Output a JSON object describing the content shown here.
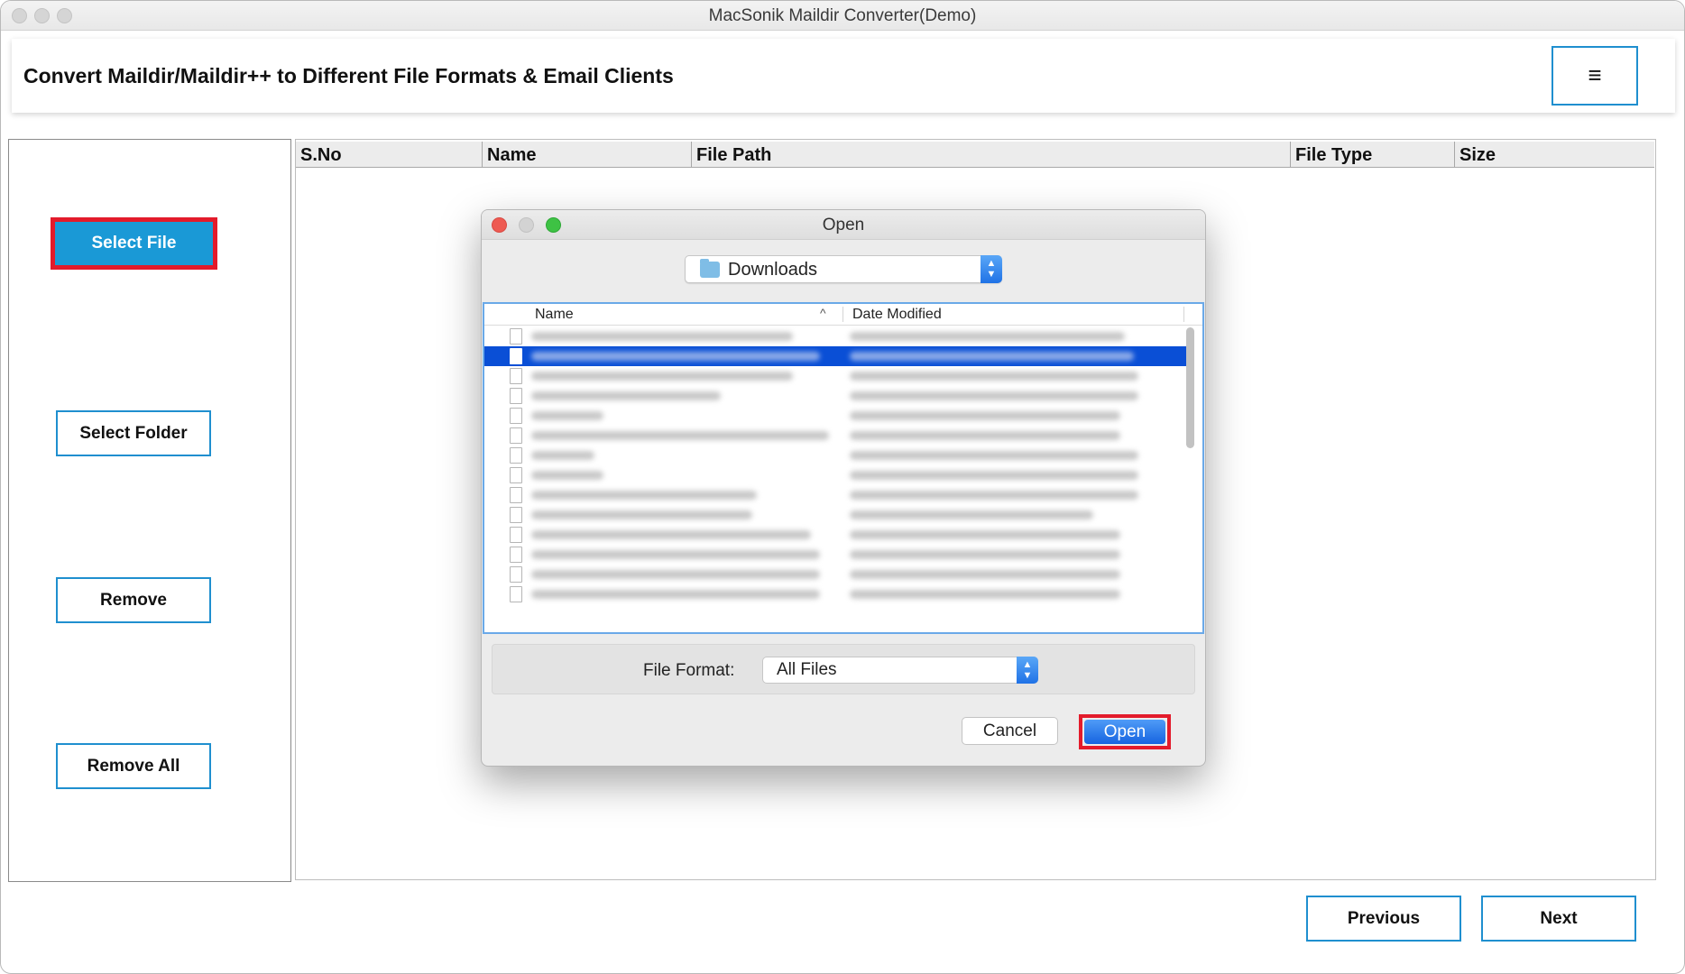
{
  "window": {
    "title": "MacSonik Maildir Converter(Demo)"
  },
  "header": {
    "heading": "Convert Maildir/Maildir++ to Different File Formats & Email Clients",
    "menu_icon": "≡"
  },
  "sidebar": {
    "select_file": "Select File",
    "select_folder": "Select Folder",
    "remove": "Remove",
    "remove_all": "Remove All"
  },
  "table": {
    "columns": [
      "S.No",
      "Name",
      "File Path",
      "File Type",
      "Size"
    ]
  },
  "footer": {
    "previous": "Previous",
    "next": "Next"
  },
  "dialog": {
    "title": "Open",
    "location": "Downloads",
    "columns": {
      "name": "Name",
      "date_modified": "Date Modified"
    },
    "file_format_label": "File Format:",
    "file_format_value": "All Files",
    "cancel": "Cancel",
    "open": "Open"
  },
  "colors": {
    "accent": "#1a99d6",
    "highlight": "#e31b2b",
    "selection": "#0a4fd6"
  },
  "icons": {
    "menu": "hamburger-icon",
    "folder": "folder-icon",
    "file": "document-icon",
    "sort": "sort-ascending-icon"
  }
}
